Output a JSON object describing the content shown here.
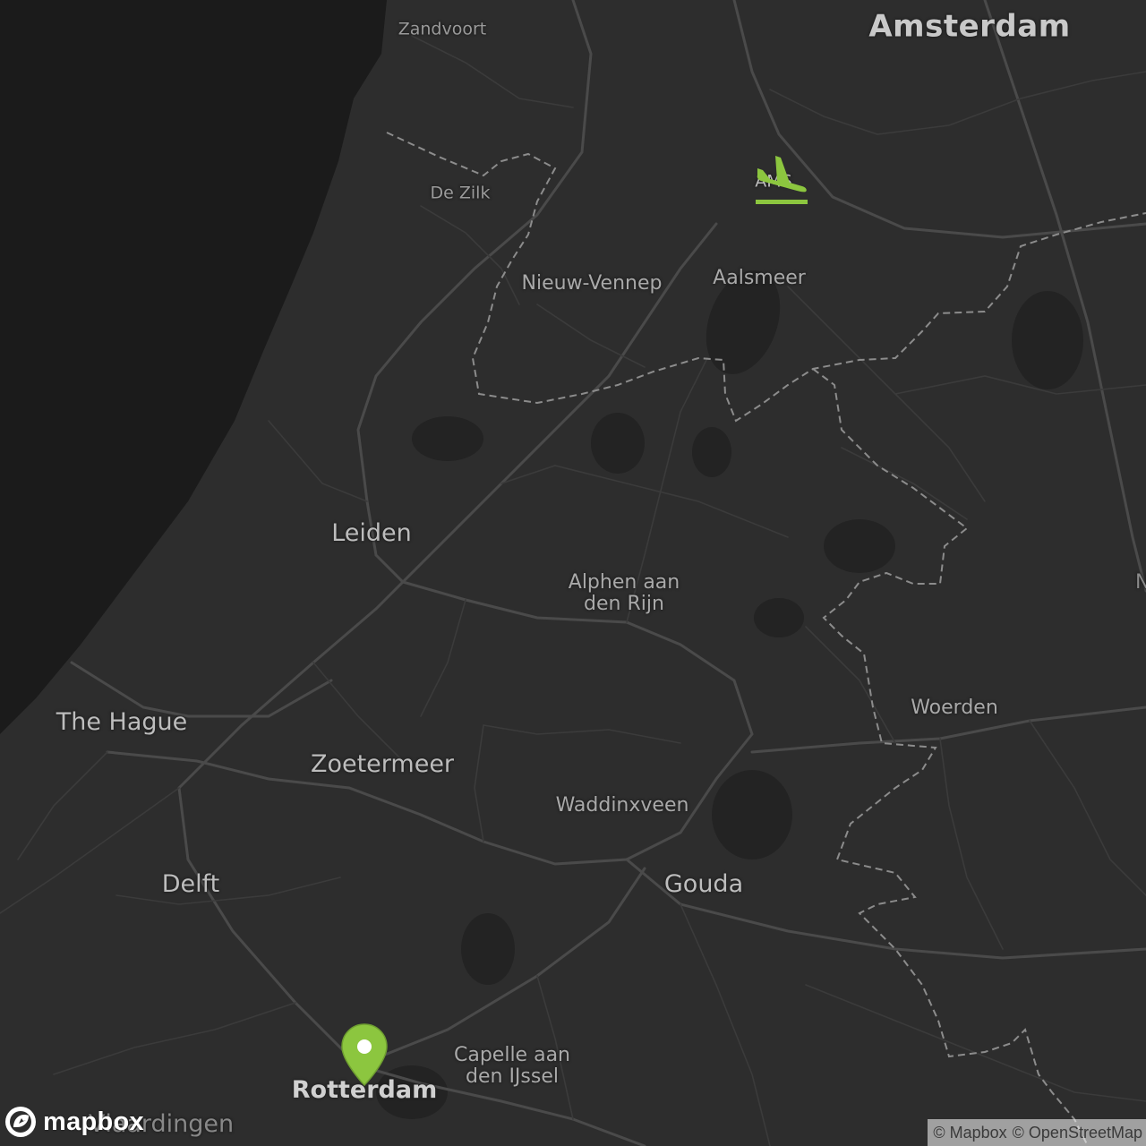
{
  "map": {
    "colors": {
      "land": "#2d2d2d",
      "sea": "#1b1b1b",
      "roads": "#4a4a4a",
      "border": "#8c8c8c",
      "marker": "#8cc63f"
    },
    "labels": {
      "amsterdam": "Amsterdam",
      "zandvoort": "Zandvoort",
      "de_zilk": "De Zilk",
      "ams": "AMS",
      "nieuw_vennep": "Nieuw-Vennep",
      "aalsmeer": "Aalsmeer",
      "leiden": "Leiden",
      "alphen": "Alphen aan\nden Rijn",
      "the_hague": "The Hague",
      "zoetermeer": "Zoetermeer",
      "woerden": "Woerden",
      "waddinxveen": "Waddinxveen",
      "delft": "Delft",
      "gouda": "Gouda",
      "capelle": "Capelle aan\nden IJssel",
      "rotterdam": "Rotterdam",
      "schiedam": "Vlaardingen",
      "edge_n": "N"
    },
    "icons": {
      "airport": "airplane-arrival-icon",
      "pin": "location-pin-icon"
    }
  },
  "branding": {
    "logo_text": "mapbox"
  },
  "attribution": {
    "mapbox": "© Mapbox",
    "osm": "© OpenStreetMap"
  }
}
